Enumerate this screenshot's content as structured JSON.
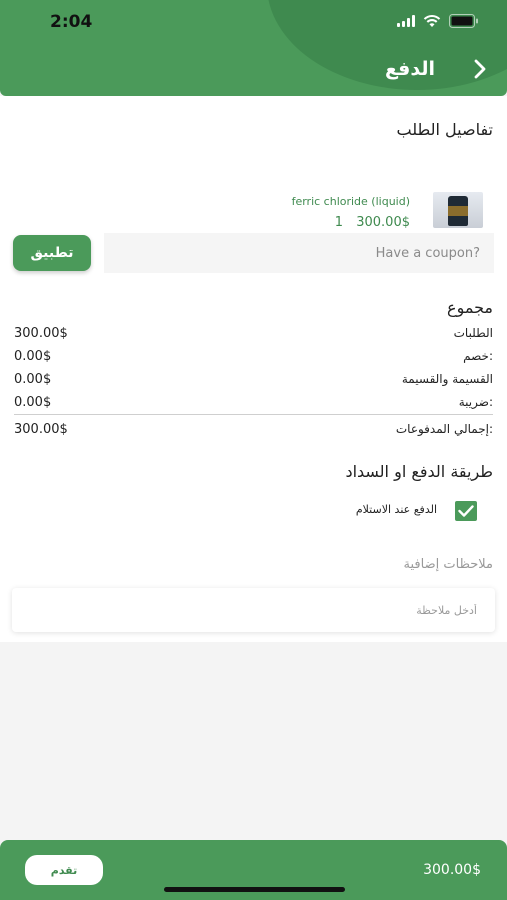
{
  "status": {
    "time": "2:04"
  },
  "header": {
    "title": "الدفع",
    "back_icon": "chevron-right-icon",
    "bg_color": "#4b9a5a"
  },
  "order": {
    "title": "تفاصيل الطلب",
    "items": [
      {
        "name": "ferric chloride (liquid)",
        "price": "300.00$",
        "quantity": "1",
        "image_icon": "product-bottle-image"
      }
    ]
  },
  "coupon": {
    "placeholder": "Have a coupon?",
    "apply_label": "تطبيق"
  },
  "summary": {
    "title": "مجموع",
    "rows": [
      {
        "label": "الطلبات",
        "value": "300.00$"
      },
      {
        "label": "خصم:",
        "value": "0.00$"
      },
      {
        "label": "القسيمة والقسيمة",
        "value": "0.00$"
      },
      {
        "label": "ضريبة:",
        "value": "0.00$"
      }
    ],
    "total_label": "إجمالي المدفوعات:",
    "total_value": "300.00$"
  },
  "payment": {
    "title": "طريقة الدفع او السداد",
    "option_label": "الدفع عند الاستلام",
    "option_checked": true
  },
  "notes": {
    "label": "ملاحظات إضافية",
    "placeholder": "أدخل ملاحظة"
  },
  "bottom": {
    "proceed_label": "تقدم",
    "total": "300.00$"
  },
  "colors": {
    "accent": "#4b9a5a",
    "dark_accent": "#3f8a4f"
  }
}
